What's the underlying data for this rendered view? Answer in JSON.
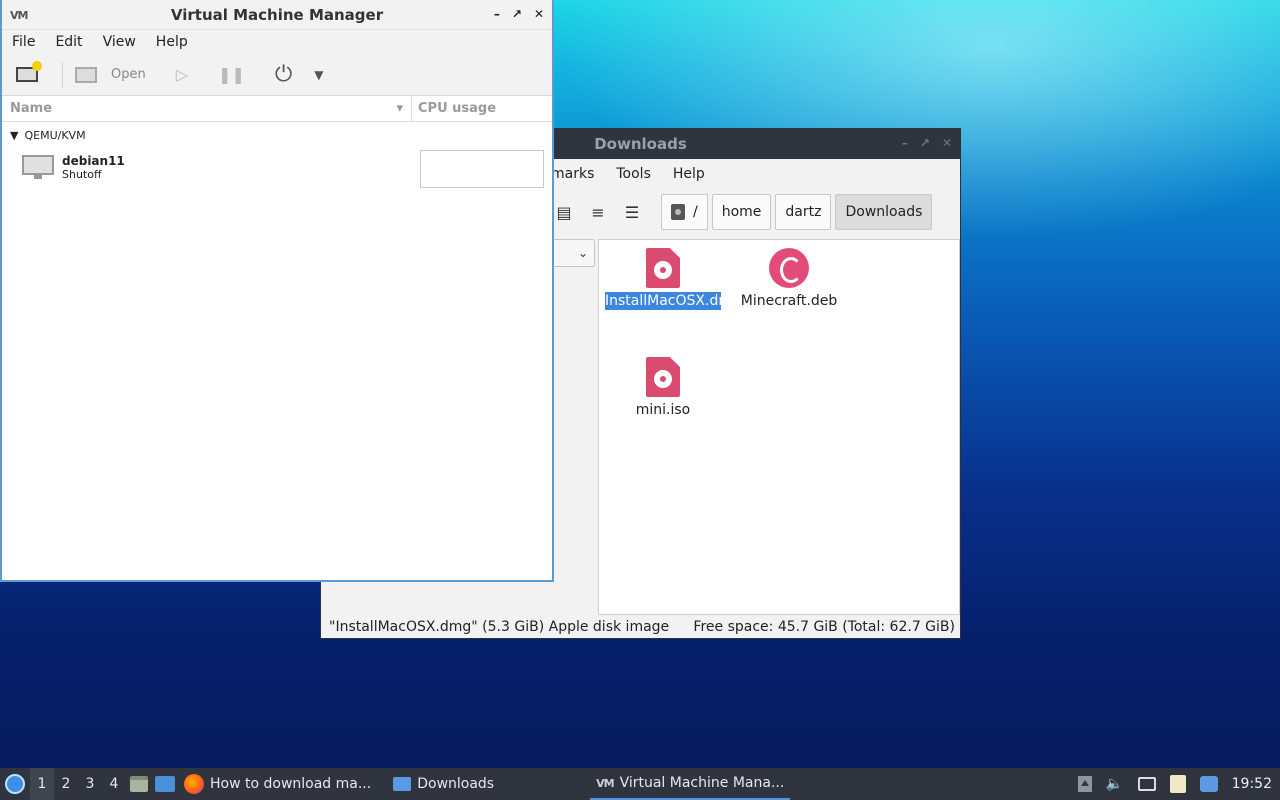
{
  "file_manager": {
    "title": "Downloads",
    "menu": [
      "marks",
      "Tools",
      "Help"
    ],
    "breadcrumb": [
      "/",
      "home",
      "dartz",
      "Downloads"
    ],
    "files": [
      {
        "name": "InstallMacOSX.dmg",
        "icon": "disk-image-icon",
        "selected": true
      },
      {
        "name": "Minecraft.deb",
        "icon": "debian-package-icon",
        "selected": false
      },
      {
        "name": "mini.iso",
        "icon": "disk-image-icon",
        "selected": false
      }
    ],
    "status_left": "\"InstallMacOSX.dmg\" (5.3 GiB) Apple disk image",
    "status_right": "Free space: 45.7 GiB (Total: 62.7 GiB)"
  },
  "vmm": {
    "title": "Virtual Machine Manager",
    "menu": [
      "File",
      "Edit",
      "View",
      "Help"
    ],
    "toolbar": {
      "open_label": "Open"
    },
    "columns": {
      "name": "Name",
      "cpu": "CPU usage"
    },
    "group": "QEMU/KVM",
    "vms": [
      {
        "name": "debian11",
        "state": "Shutoff"
      }
    ]
  },
  "taskbar": {
    "workspaces": [
      "1",
      "2",
      "3",
      "4"
    ],
    "active_workspace": "1",
    "tasks": [
      {
        "label": "How to download ma...",
        "icon": "firefox-icon"
      },
      {
        "label": "Downloads",
        "icon": "folder-icon"
      },
      {
        "label": "Virtual Machine Mana...",
        "icon": "vmm-icon"
      }
    ],
    "clock": "19:52"
  },
  "colors": {
    "selection": "#3d86e0",
    "titlebar_dark": "#2f343f",
    "accent": "#5294e2"
  }
}
